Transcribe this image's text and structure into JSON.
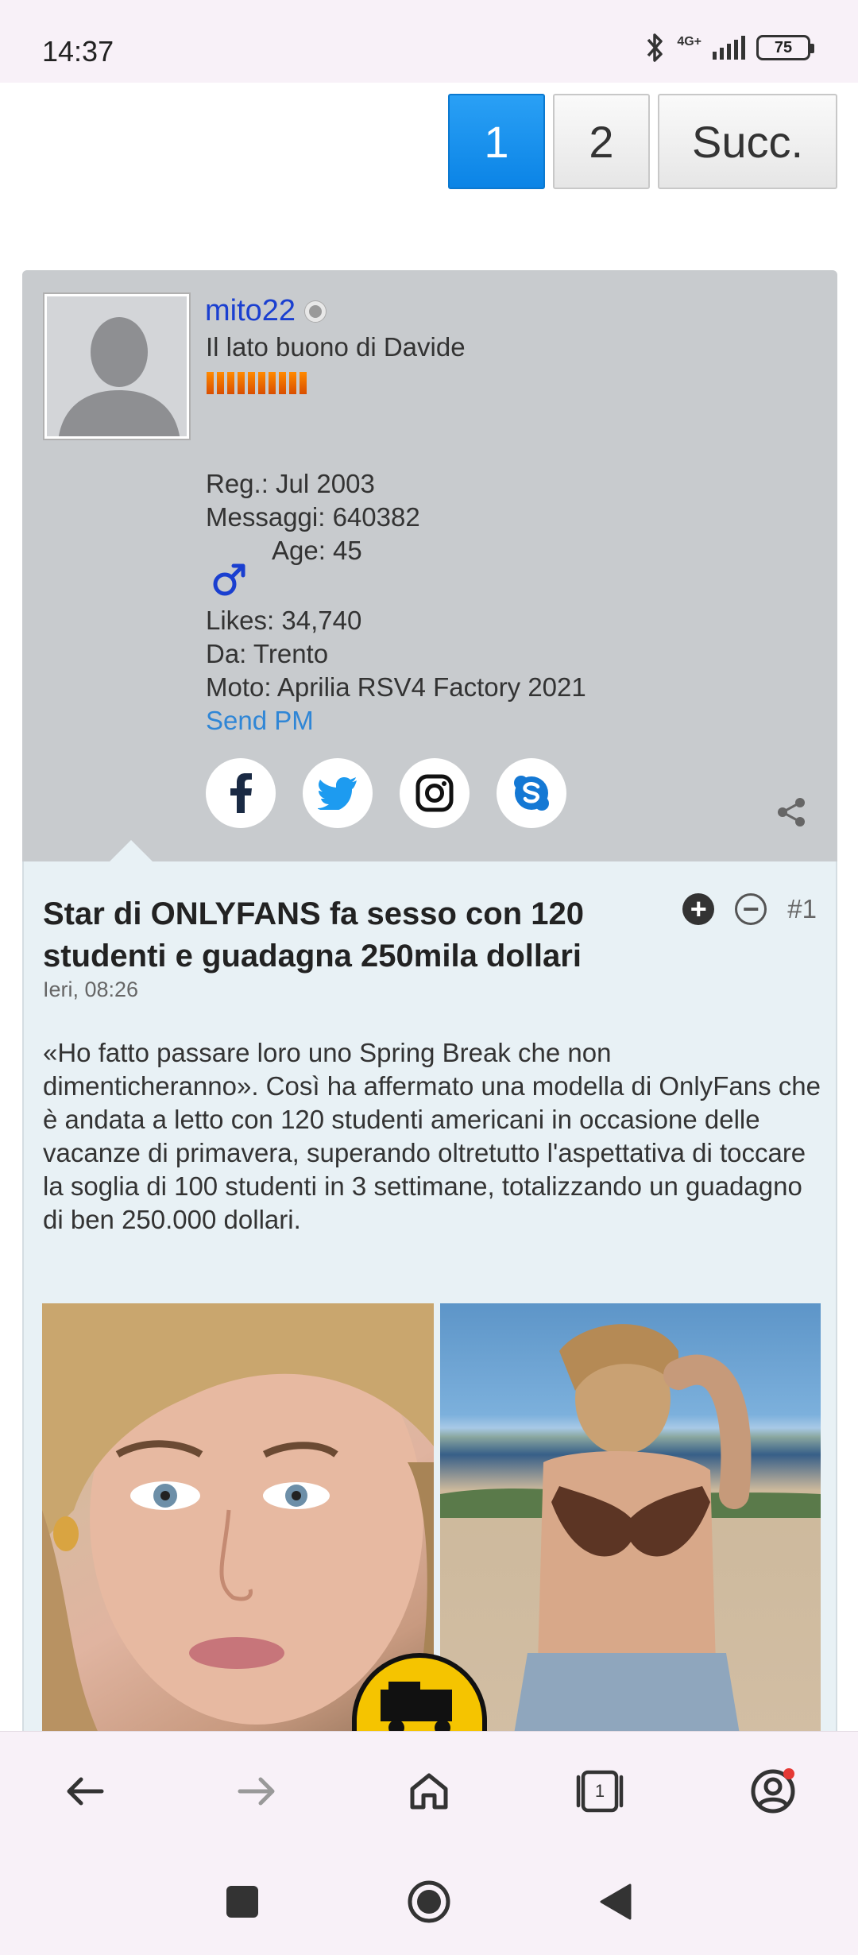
{
  "status_bar": {
    "time": "14:37",
    "network": "4G+",
    "battery": "75"
  },
  "pagination": {
    "pages": [
      "1",
      "2"
    ],
    "active_page": "1",
    "next_label": "Succ."
  },
  "profile": {
    "username": "mito22",
    "user_title": "Il lato buono di Davide",
    "reputation_bars": 10,
    "registered": "Reg.: Jul 2003",
    "messages": "Messaggi: 640382",
    "age": "Age: 45",
    "gender_icon": "male-symbol-icon",
    "likes": "Likes: 34,740",
    "location": "Da: Trento",
    "bike": "Moto: Aprilia RSV4 Factory 2021",
    "send_pm": "Send PM",
    "social": [
      "facebook-icon",
      "twitter-icon",
      "instagram-icon",
      "skype-icon"
    ]
  },
  "post": {
    "title": "Star di ONLYFANS fa sesso con 120 studenti e guadagna 250mila dollari",
    "date": "Ieri, 08:26",
    "number": "#1",
    "body": "«Ho fatto passare loro uno Spring Break che non dimenticheranno». Così ha affermato una modella di OnlyFans che è andata a letto con 120 studenti americani in occasione delle vacanze di primavera, superando oltretutto l'aspettativa di toccare la soglia di 100 studenti in 3 settimane, totalizzando un guadagno di ben 250.000 dollari."
  },
  "browser_bar": {
    "tabs_count": "1",
    "icons": [
      "back-arrow-icon",
      "forward-arrow-icon",
      "home-icon",
      "tabs-icon",
      "account-icon"
    ]
  },
  "colors": {
    "accent_blue": "#0b84e6",
    "username_blue": "#1a3fd0",
    "link_blue": "#2f86d6",
    "card_grey": "#c8cbce",
    "post_bg": "#e8f1f5"
  }
}
